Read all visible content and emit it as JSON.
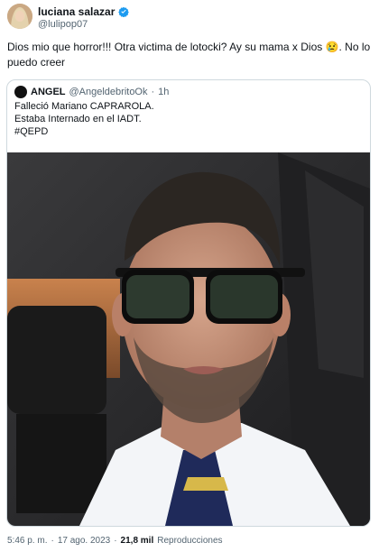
{
  "post": {
    "author_name": "luciana salazar",
    "author_handle": "@lulipop07",
    "text": "Dios mio que horror!!! Otra victima de lotocki? Ay su mama x Dios 😢. No lo puedo creer"
  },
  "quote": {
    "author_name": "ANGEL",
    "author_handle": "@AngeldebritoOk",
    "separator": "·",
    "time": "1h",
    "lines": [
      "Falleció Mariano CAPRAROLA.",
      "Estaba Internado en el IADT.",
      "#QEPD"
    ]
  },
  "footer": {
    "time": "5:46 p. m.",
    "dot1": "·",
    "date": "17 ago. 2023",
    "dot2": "·",
    "views_count": "21,8 mil",
    "views_label": "Reproducciones"
  },
  "colors": {
    "verified": "#1d9bf0",
    "border": "#cfd9de",
    "secondary_text": "#536471"
  },
  "icons": {
    "verified": "verified-badge-icon"
  }
}
